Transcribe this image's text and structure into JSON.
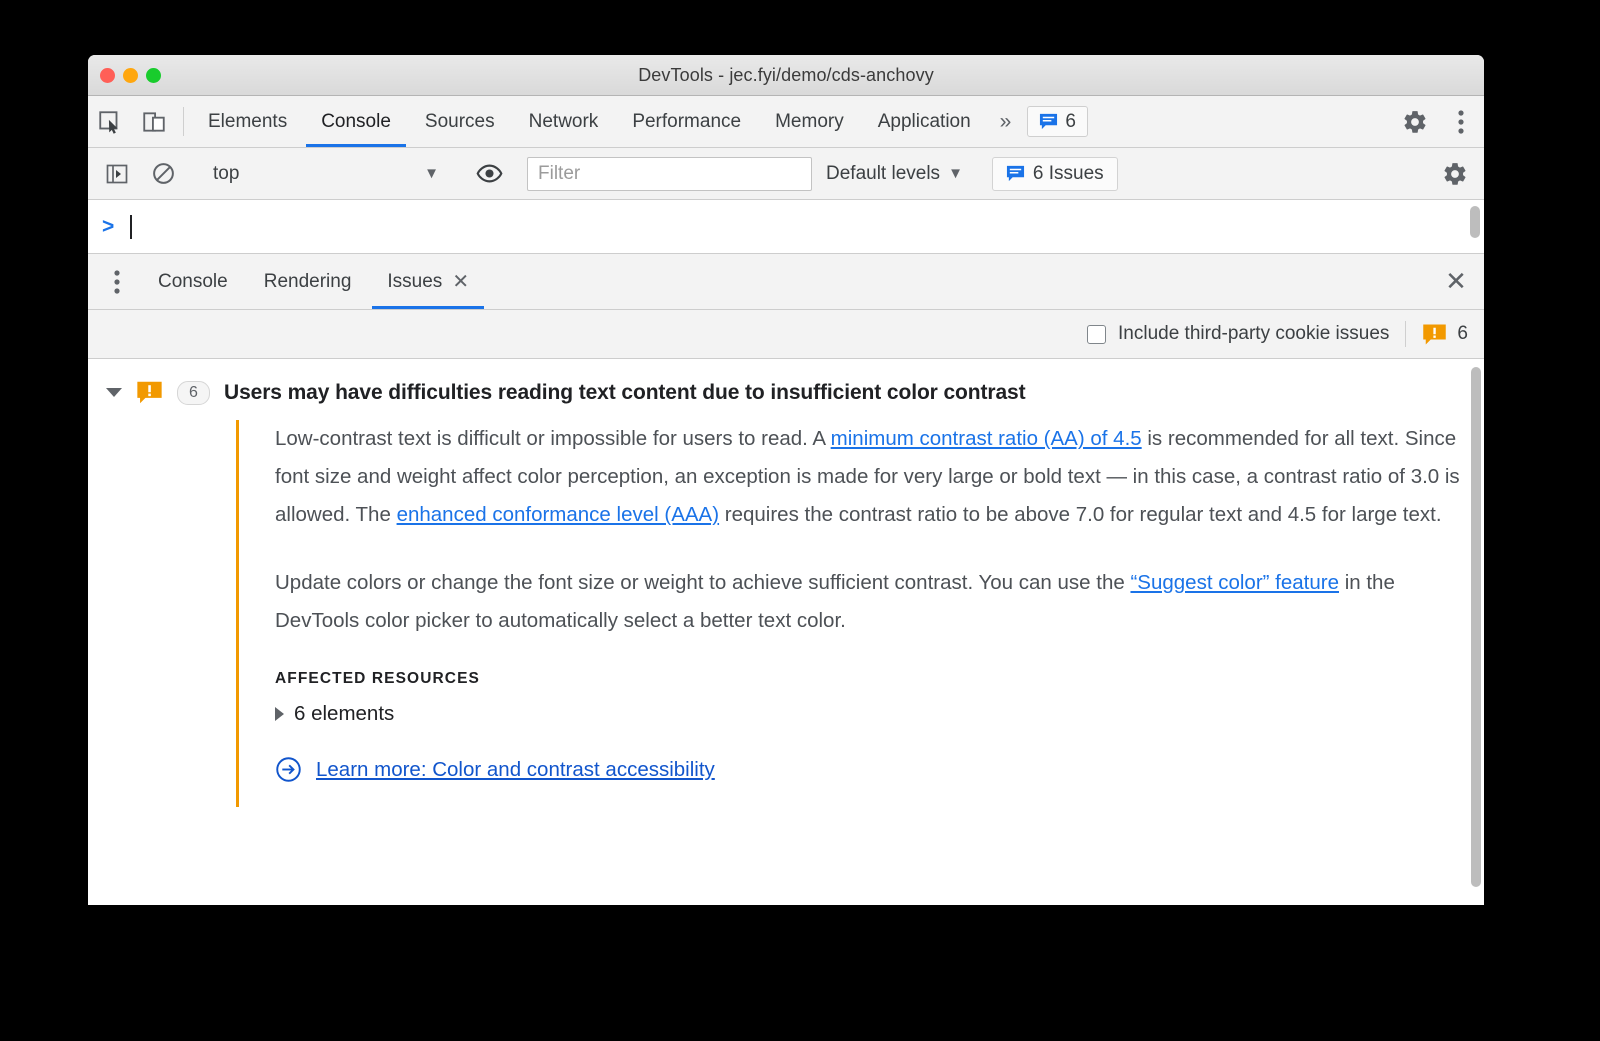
{
  "window": {
    "title": "DevTools - jec.fyi/demo/cds-anchovy",
    "traffic_lights": [
      "close",
      "minimize",
      "zoom"
    ],
    "colors": {
      "accent_blue": "#1a73e8",
      "link_blue": "#1155cc",
      "warning_orange": "#f29900",
      "light_red": "#ff5f57",
      "light_amber": "#ffa70f",
      "light_green": "#19cc2d"
    }
  },
  "main_tabs": {
    "icons": [
      "inspect-element-icon",
      "device-toolbar-icon"
    ],
    "items": [
      {
        "label": "Elements",
        "active": false
      },
      {
        "label": "Console",
        "active": true
      },
      {
        "label": "Sources",
        "active": false
      },
      {
        "label": "Network",
        "active": false
      },
      {
        "label": "Performance",
        "active": false
      },
      {
        "label": "Memory",
        "active": false
      },
      {
        "label": "Application",
        "active": false
      }
    ],
    "overflow_label": "»",
    "issue_badge_count": "6",
    "settings_icon": "gear-icon",
    "more_icon": "more-vertical-icon"
  },
  "console_toolbar": {
    "sidebar_toggle_icon": "console-sidebar-icon",
    "clear_icon": "clear-console-icon",
    "context_value": "top",
    "context_caret": "▼",
    "live_expression_icon": "eye-icon",
    "filter_placeholder": "Filter",
    "filter_value": "",
    "levels_label": "Default levels",
    "levels_caret": "▼",
    "issues_button_label": "6 Issues",
    "settings_icon": "gear-icon"
  },
  "console_prompt": {
    "arrow": ">",
    "value": ""
  },
  "drawer": {
    "more_icon": "more-vertical-icon",
    "tabs": [
      {
        "label": "Console",
        "active": false,
        "closable": false
      },
      {
        "label": "Rendering",
        "active": false,
        "closable": false
      },
      {
        "label": "Issues",
        "active": true,
        "closable": true
      }
    ],
    "close_label": "✕",
    "tab_close_label": "✕"
  },
  "issues_toolbar": {
    "third_party_checkbox_label": "Include third-party cookie issues",
    "third_party_checked": false,
    "warning_icon": "warning-issue-icon",
    "warning_count": "6"
  },
  "issue": {
    "expanded": true,
    "severity_icon": "warning-issue-icon",
    "count": "6",
    "title": "Users may have difficulties reading text content due to insufficient color contrast",
    "paragraph1": {
      "part1": "Low-contrast text is difficult or impossible for users to read. A ",
      "link1": "minimum contrast ratio (AA) of 4.5",
      "part2": " is recommended for all text. Since font size and weight affect color perception, an exception is made for very large or bold text — in this case, a contrast ratio of 3.0 is allowed. The ",
      "link2": "enhanced conformance level (AAA)",
      "part3": " requires the contrast ratio to be above 7.0 for regular text and 4.5 for large text."
    },
    "paragraph2": {
      "part1": "Update colors or change the font size or weight to achieve sufficient contrast. You can use the ",
      "link1": "“Suggest color” feature",
      "part2": " in the DevTools color picker to automatically select a better text color."
    },
    "affected_resources_title": "AFFECTED RESOURCES",
    "affected_resource_item": "6 elements",
    "affected_resource_caret": "▶",
    "learn_more_icon": "circled-arrow-icon",
    "learn_more_label": "Learn more: Color and contrast accessibility"
  }
}
